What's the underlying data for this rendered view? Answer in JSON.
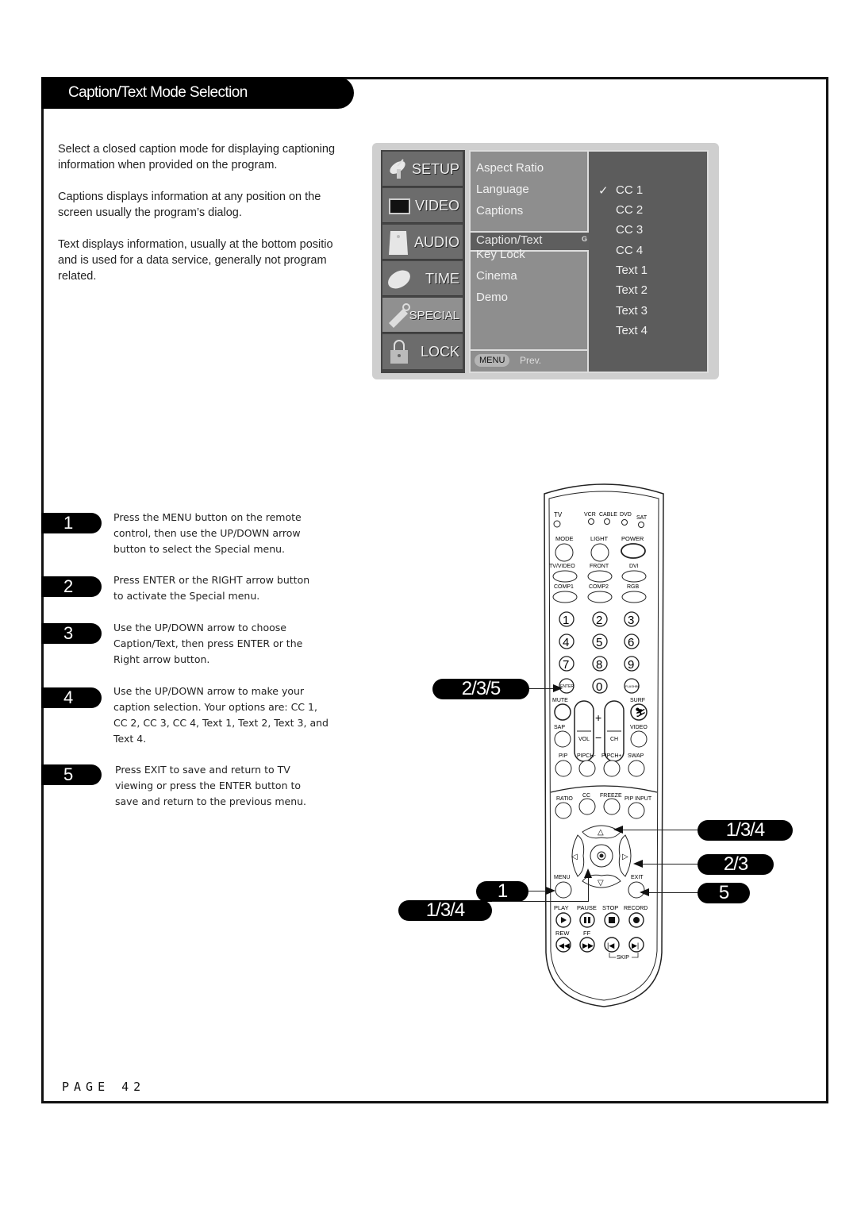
{
  "section_title": "Caption/Text Mode Selection",
  "intro": [
    "Select a closed caption mode for displaying captioning information when provided on the program.",
    "Captions displays information at any position on the screen usually the program's dialog.",
    "Text displays information, usually at the bottom position and is used for a data service, generally not program related."
  ],
  "intro_lines": {
    "p1a": "Select a closed caption mode for displaying captioning",
    "p1b": "information when provided on the program.",
    "p2a": "Captions displays information at any position on the",
    "p2b": "screen usually the program’s dialog.",
    "p3a": "Text displays information, usually at the bottom positio",
    "p3b": "and is used for a data service, generally not program",
    "p3c": "related."
  },
  "osd": {
    "side_menu": [
      {
        "label": "SETUP",
        "icon": "satellite-dish-icon"
      },
      {
        "label": "VIDEO",
        "icon": "tv-screen-icon"
      },
      {
        "label": "AUDIO",
        "icon": "speaker-icon"
      },
      {
        "label": "TIME",
        "icon": "clock-dish-icon"
      },
      {
        "label": "SPECIAL",
        "icon": "tag-icon",
        "active": true
      },
      {
        "label": "LOCK",
        "icon": "padlock-icon"
      }
    ],
    "submenu": [
      "Aspect Ratio",
      "Language",
      "Captions",
      "Caption/Text",
      "Key Lock",
      "Cinema",
      "Demo"
    ],
    "selected_submenu": "Caption/Text",
    "selected_indicator": "G",
    "footer": {
      "menu_button": "MENU",
      "prev_label": "Prev."
    },
    "options": [
      "CC 1",
      "CC 2",
      "CC 3",
      "CC 4",
      "Text 1",
      "Text 2",
      "Text 3",
      "Text 4"
    ],
    "checked_option": "CC 1",
    "check_mark": "✓"
  },
  "steps": [
    {
      "number": "1",
      "lines": [
        "Press the MENU button on the remote",
        "control, then use the UP/DOWN arrow",
        "button to select the Special menu."
      ]
    },
    {
      "number": "2",
      "lines": [
        "Press ENTER or the RIGHT arrow button",
        "to activate the Special menu."
      ]
    },
    {
      "number": "3",
      "lines": [
        "Use the UP/DOWN arrow to choose",
        "Caption/Text, then press ENTER or the",
        "Right arrow button."
      ]
    },
    {
      "number": "4",
      "lines": [
        "Use the UP/DOWN arrow to make your",
        "caption selection. Your options are: CC 1,",
        "CC 2, CC 3, CC 4, Text 1, Text 2, Text 3, and",
        "Text 4."
      ]
    },
    {
      "number": "5",
      "lines": [
        "Press EXIT to save and return to TV",
        "viewing or press the ENTER button to",
        "save and return to the previous menu."
      ]
    }
  ],
  "remote": {
    "source_labels": [
      "TV",
      "VCR",
      "CABLE",
      "DVD",
      "SAT"
    ],
    "row1": [
      "MODE",
      "LIGHT",
      "POWER"
    ],
    "row2": [
      "TV/VIDEO",
      "FRONT",
      "DVI"
    ],
    "row3": [
      "COMP1",
      "COMP2",
      "RGB"
    ],
    "digits": [
      "1",
      "2",
      "3",
      "4",
      "5",
      "6",
      "7",
      "8",
      "9",
      "ENTER",
      "0",
      "FLASHBK"
    ],
    "mute": "MUTE",
    "surf": "SURF",
    "sap": "SAP",
    "video": "VIDEO",
    "vol": "VOL",
    "ch": "CH",
    "plus": "+",
    "minus": "−",
    "pip_row": [
      "PIP",
      "PIPCH-",
      "PIPCH+",
      "SWAP"
    ],
    "func_row": [
      "RATIO",
      "CC",
      "FREEZE",
      "PIP INPUT"
    ],
    "menu": "MENU",
    "exit": "EXIT",
    "transport1": [
      "PLAY",
      "PAUSE",
      "STOP",
      "RECORD"
    ],
    "transport2": [
      "REW",
      "FF"
    ],
    "skip": "SKIP"
  },
  "callouts": {
    "enter": "2/3/5",
    "up": "1/3/4",
    "right": "2/3",
    "exit": "5",
    "menu": "1",
    "down": "1/3/4"
  },
  "page_label": "PAGE 42"
}
